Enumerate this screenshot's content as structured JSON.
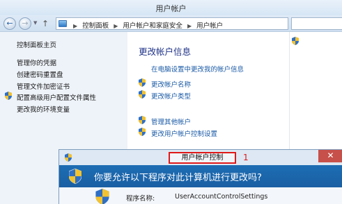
{
  "window": {
    "title": "用户帐户"
  },
  "address_bar": {
    "crumbs": [
      "控制面板",
      "用户帐户和家庭安全",
      "用户帐户"
    ]
  },
  "sidebar": {
    "home": "控制面板主页",
    "items": [
      "管理你的凭据",
      "创建密码重置盘",
      "管理文件加密证书",
      "配置高级用户配置文件属性",
      "更改我的环境变量"
    ]
  },
  "main": {
    "section_title": "更改帐户信息",
    "pc_settings_link": "在电脑设置中更改我的帐户信息",
    "links": [
      "更改帐户名称",
      "更改帐户类型",
      "管理其他帐户",
      "更改用户帐户控制设置"
    ]
  },
  "uac": {
    "title": "用户帐户控制",
    "step_number": "1",
    "close": "✕",
    "question": "你要允许以下程序对此计算机进行更改吗?",
    "program_name_label": "程序名称:",
    "program_name_value": "UserAccountControlSettings"
  },
  "icons": {
    "back": "arrow-left-icon",
    "forward": "arrow-right-icon",
    "up": "arrow-up-icon",
    "shield": "uac-shield-icon"
  },
  "colors": {
    "link": "#1a5aa6",
    "section_title": "#1e3287",
    "highlight": "#e01818",
    "uac_header": "#1d6db4",
    "close": "#c7504a"
  }
}
